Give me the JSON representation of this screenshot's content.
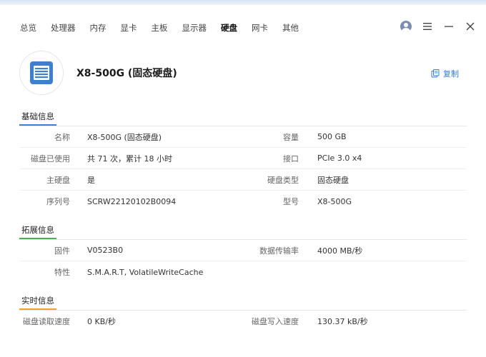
{
  "nav": {
    "tabs": [
      {
        "label": "总览"
      },
      {
        "label": "处理器"
      },
      {
        "label": "内存"
      },
      {
        "label": "显卡"
      },
      {
        "label": "主板"
      },
      {
        "label": "显示器"
      },
      {
        "label": "硬盘"
      },
      {
        "label": "网卡"
      },
      {
        "label": "其他"
      }
    ],
    "active_tab": "硬盘"
  },
  "window_controls": [
    "avatar-icon",
    "menu-icon",
    "minimize-icon",
    "close-icon"
  ],
  "device": {
    "title": "X8-500G (固态硬盘)",
    "icon": "disk-icon",
    "copy_label": "复制"
  },
  "colors": {
    "accent_blue": "#2f7bd8",
    "basic_underline": "#3b82d6",
    "extended_underline": "#4caf50",
    "realtime_underline": "#f0a030"
  },
  "basic": {
    "title": "基础信息",
    "rows": [
      {
        "l1": "名称",
        "v1": "X8-500G (固态硬盘)",
        "l2": "容量",
        "v2": "500 GB"
      },
      {
        "l1": "磁盘已使用",
        "v1": "共 71 次，累计 18 小时",
        "l2": "接口",
        "v2": "PCIe 3.0 x4"
      },
      {
        "l1": "主硬盘",
        "v1": "是",
        "l2": "硬盘类型",
        "v2": "固态硬盘"
      },
      {
        "l1": "序列号",
        "v1": "SCRW22120102B0094",
        "l2": "型号",
        "v2": "X8-500G"
      }
    ]
  },
  "extended": {
    "title": "拓展信息",
    "rows": [
      {
        "l1": "固件",
        "v1": "V0523B0",
        "l2": "数据传输率",
        "v2": "4000 MB/秒"
      },
      {
        "l1": "特性",
        "v1": "S.M.A.R.T, VolatileWriteCache",
        "l2": "",
        "v2": ""
      }
    ]
  },
  "realtime": {
    "title": "实时信息",
    "rows": [
      {
        "l1": "磁盘读取速度",
        "v1": "0 KB/秒",
        "l2": "磁盘写入速度",
        "v2": "130.37 kB/秒"
      }
    ]
  }
}
